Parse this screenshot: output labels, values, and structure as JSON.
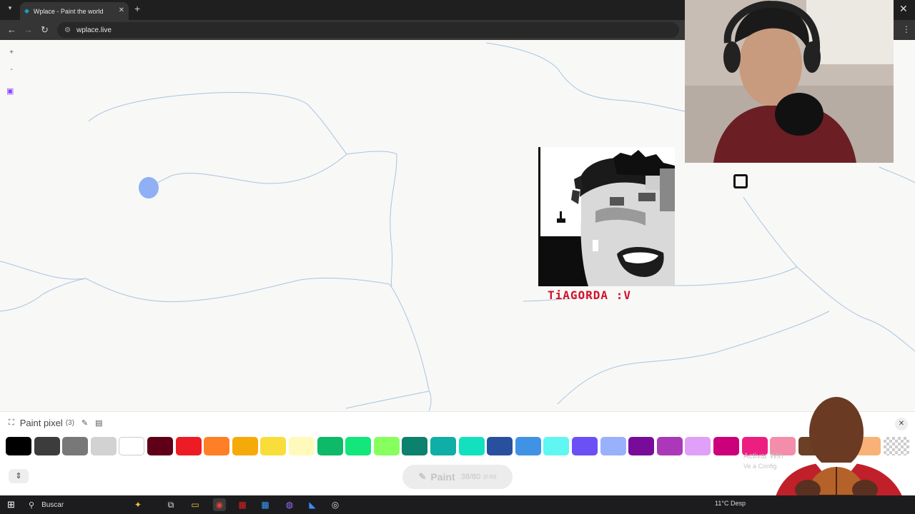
{
  "browser": {
    "tab_title": "Wplace - Paint the world",
    "tab_close": "✕",
    "new_tab": "+",
    "url": "wplace.live",
    "window_close": "✕"
  },
  "map": {
    "zoom_in": "+",
    "zoom_out": "-",
    "pixel_art_caption": "TiAGORDA :V"
  },
  "paint_panel": {
    "title": "Paint pixel",
    "count": "(3)",
    "close": "✕",
    "palette": [
      "#000000",
      "#3c3c3c",
      "#787878",
      "#d2d2d2",
      "#ffffff",
      "#600018",
      "#ed1c24",
      "#ff7f27",
      "#f6aa09",
      "#f9dd3b",
      "#fffabc",
      "#0eb968",
      "#13e67b",
      "#87ff5e",
      "#0c816e",
      "#10aea6",
      "#13e1be",
      "#28509e",
      "#4093e4",
      "#60f7f2",
      "#6b50f6",
      "#99b1fb",
      "#780c99",
      "#aa38b9",
      "#e09ff9",
      "#cb007a",
      "#ec1f80",
      "#f38da9",
      "#6b4026",
      "#95682a",
      "#f8b277",
      "transparent"
    ],
    "selected_index": 4,
    "paint_button": "Paint",
    "paint_progress": "38/80",
    "paint_coords": "(0:00)"
  },
  "overlay": {
    "watermark_line1": "Activar Win",
    "watermark_line2": "Ve a Config"
  },
  "taskbar": {
    "search_placeholder": "Buscar",
    "weather": "11°C  Desp"
  }
}
